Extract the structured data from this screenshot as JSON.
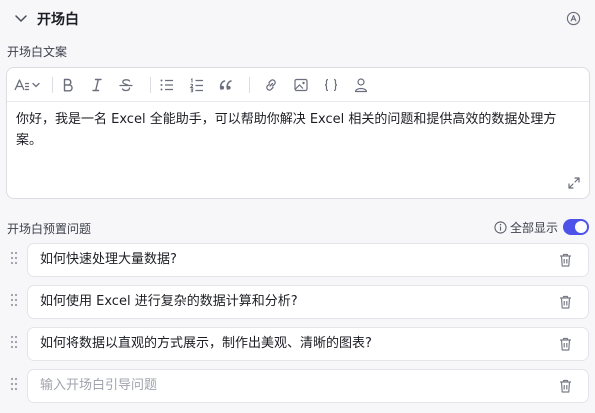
{
  "section": {
    "title": "开场白"
  },
  "opening_text": {
    "label": "开场白文案",
    "content": "你好，我是一名 Excel 全能助手，可以帮助你解决 Excel 相关的问题和提供高效的数据处理方案。"
  },
  "preset_questions": {
    "label": "开场白预置问题",
    "show_all_label": "全部显示",
    "show_all_enabled": true,
    "items": [
      {
        "text": "如何快速处理大量数据?"
      },
      {
        "text": "如何使用 Excel 进行复杂的数据计算和分析?"
      },
      {
        "text": "如何将数据以直观的方式展示，制作出美观、清晰的图表?"
      }
    ],
    "new_placeholder": "输入开场白引导问题"
  },
  "colors": {
    "accent": "#4d53e8"
  }
}
